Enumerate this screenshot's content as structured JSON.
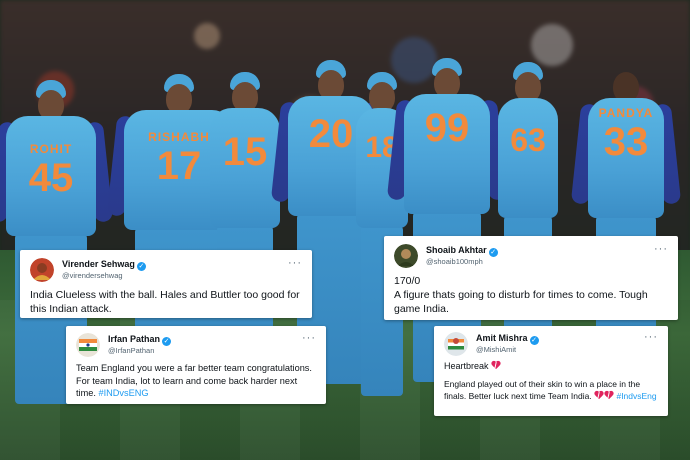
{
  "players": [
    {
      "name": "ROHIT",
      "number": "45"
    },
    {
      "name": "RISHABH",
      "number": "17"
    },
    {
      "name": "",
      "number": "15"
    },
    {
      "name": "",
      "number": "20"
    },
    {
      "name": "",
      "number": "18"
    },
    {
      "name": "",
      "number": "99"
    },
    {
      "name": "",
      "number": "63"
    },
    {
      "name": "PANDYA",
      "number": "33"
    }
  ],
  "tweets": [
    {
      "id": "sehwag",
      "name": "Virender Sehwag",
      "handle": "@virendersehwag",
      "more": "···",
      "text": "India Clueless with the ball. Hales and Buttler too good for this Indian attack."
    },
    {
      "id": "akhtar",
      "name": "Shoaib Akhtar",
      "handle": "@shoaib100mph",
      "more": "···",
      "line1": "170/0",
      "line2": "A figure thats going to disturb for times to come. Tough game India."
    },
    {
      "id": "pathan",
      "name": "Irfan Pathan",
      "handle": "@IrfanPathan",
      "more": "···",
      "text": "Team England you were a far better team congratulations. For team India, lot to learn and come back harder next time.",
      "hashtag": "#INDvsENG"
    },
    {
      "id": "mishra",
      "name": "Amit Mishra",
      "handle": "@MishiAmit",
      "more": "···",
      "line1": "Heartbreak",
      "line2": "England played out of their skin to win a place in the finals. Better luck next time Team India.",
      "hashtag": "#IndvsEng"
    }
  ],
  "colors": {
    "jersey": "#4aa5d8",
    "jersey_numbers": "#f28a3c",
    "verified": "#1d9bf0",
    "hashtag": "#1d9bf0",
    "heart": "#e0245e"
  },
  "icons": [
    "verified-badge-icon",
    "more-options-icon",
    "broken-heart-icon"
  ]
}
